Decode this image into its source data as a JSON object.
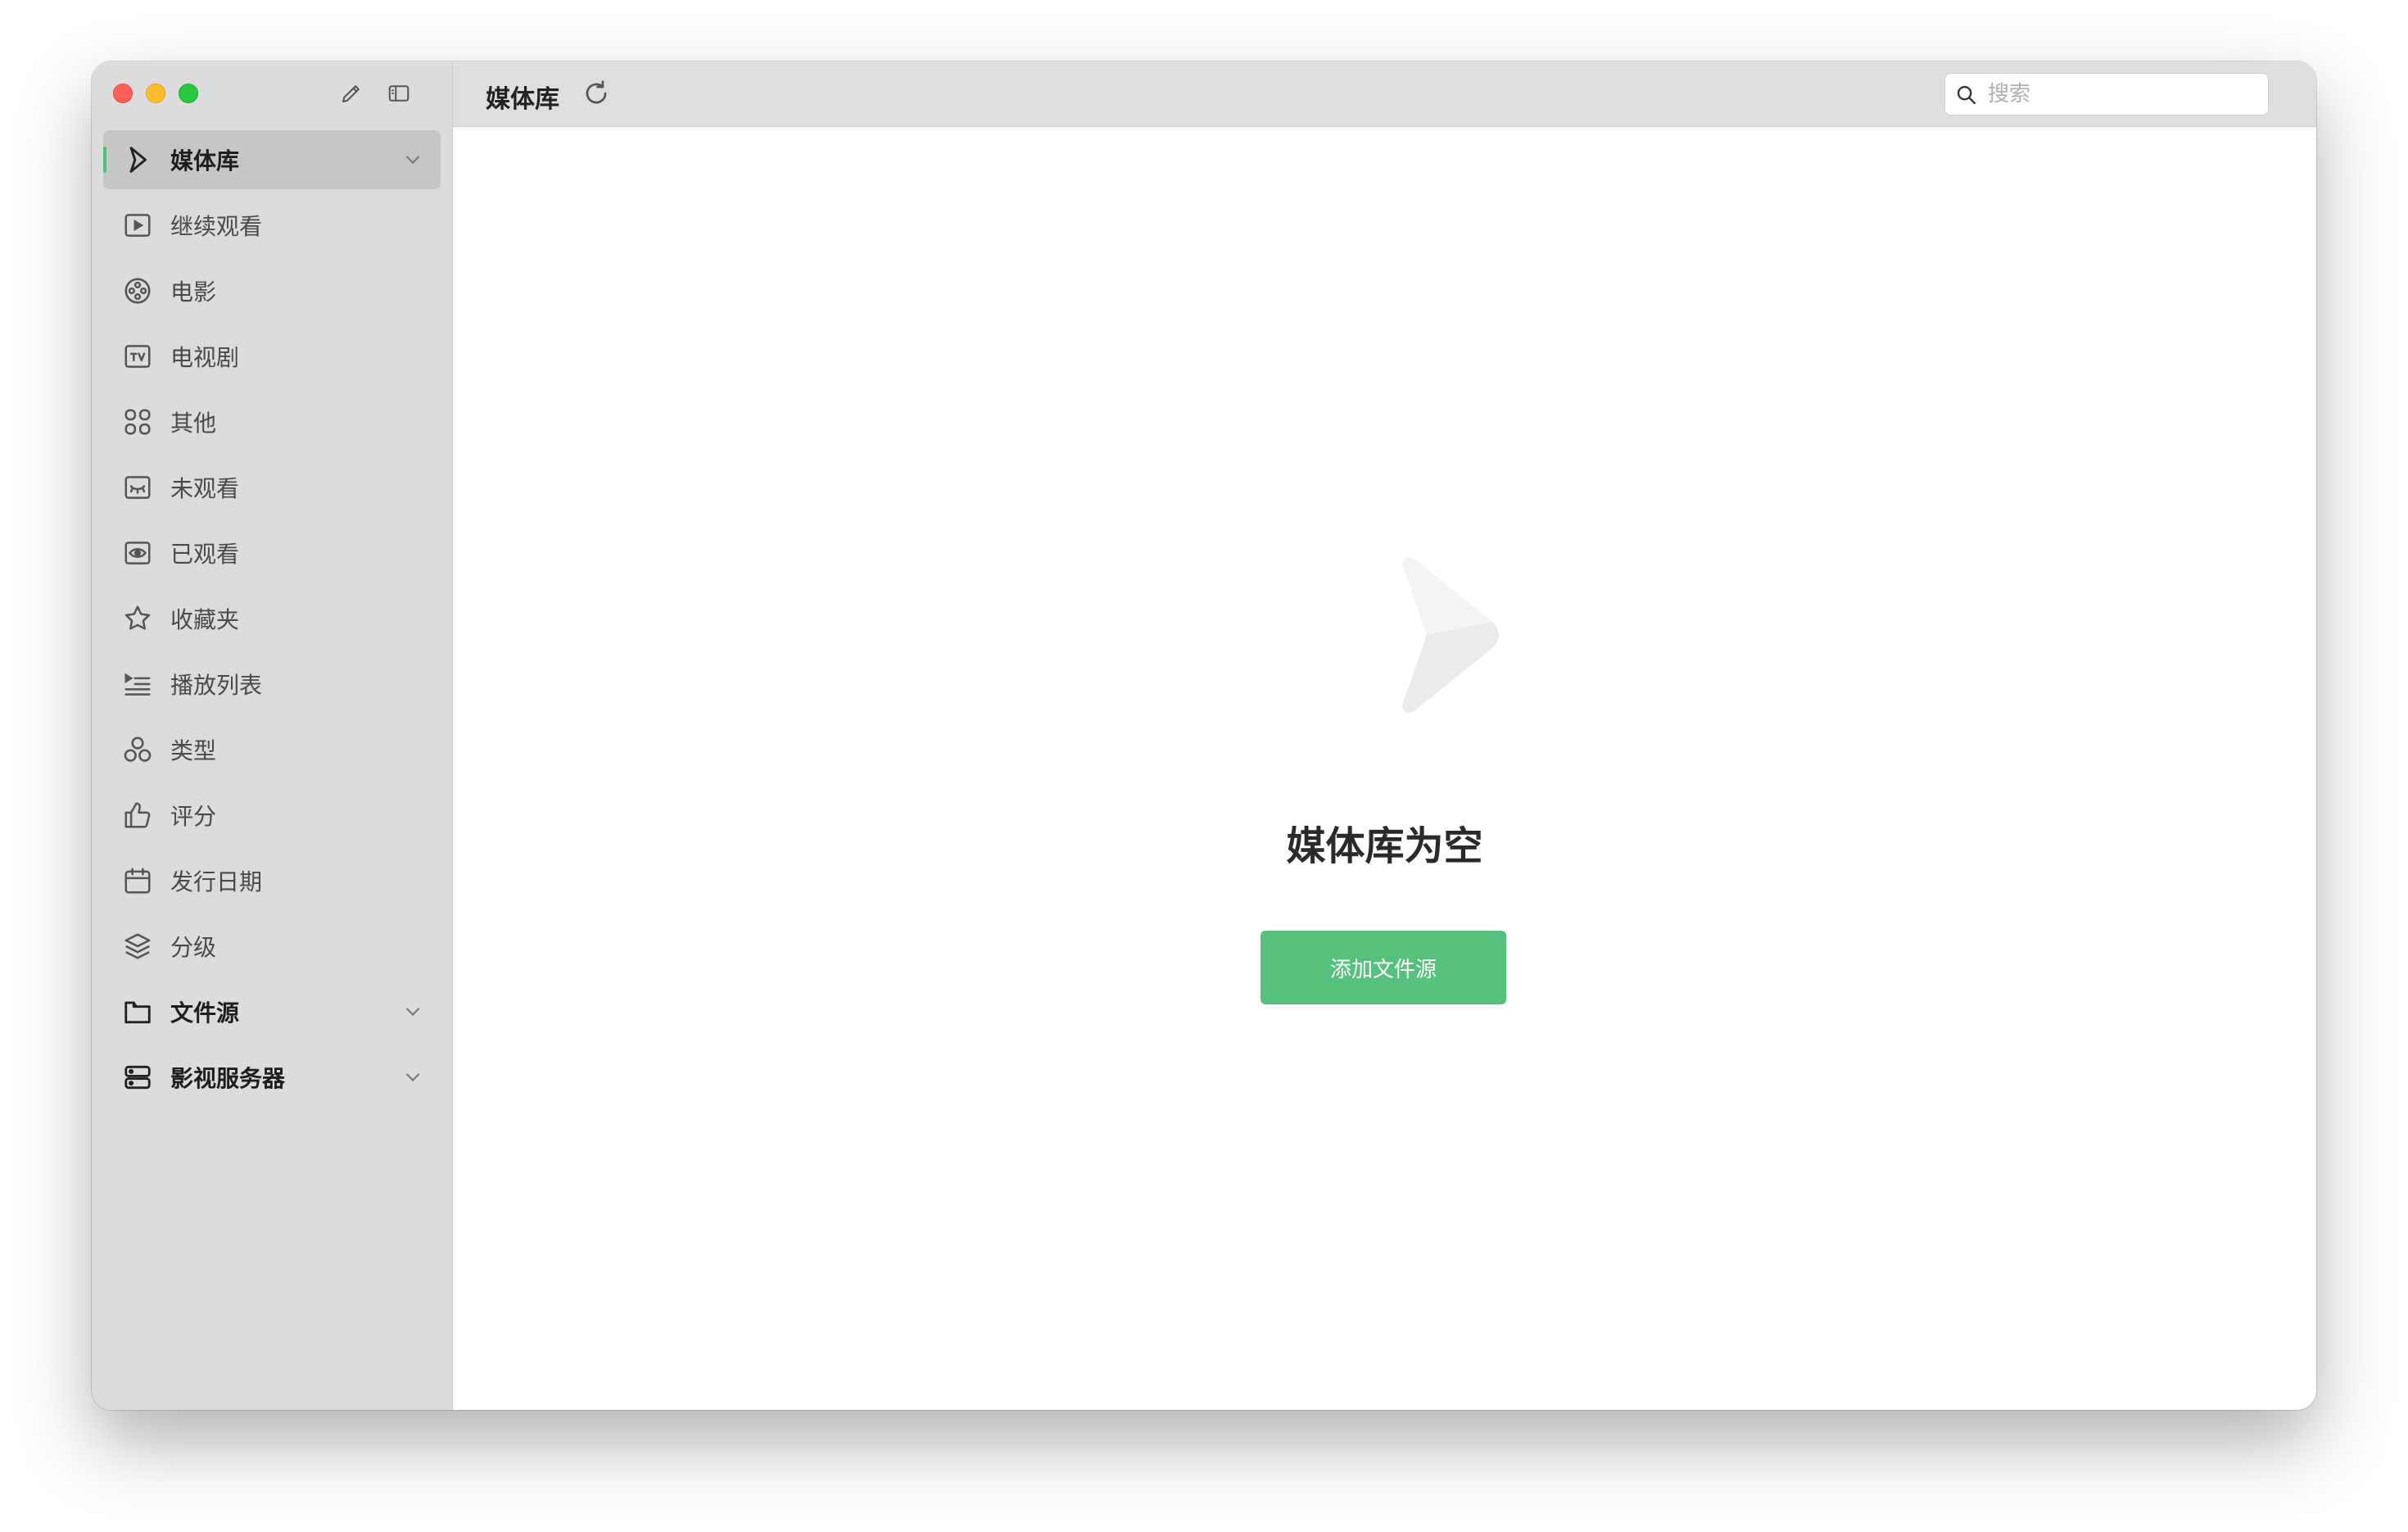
{
  "toolbar": {
    "title": "媒体库",
    "search_placeholder": "搜索"
  },
  "sidebar": {
    "items": [
      {
        "label": "媒体库",
        "icon": "media-library-icon"
      },
      {
        "label": "继续观看",
        "icon": "play-square-icon"
      },
      {
        "label": "电影",
        "icon": "film-reel-icon"
      },
      {
        "label": "电视剧",
        "icon": "tv-icon"
      },
      {
        "label": "其他",
        "icon": "grid-icon"
      },
      {
        "label": "未观看",
        "icon": "eye-closed-icon"
      },
      {
        "label": "已观看",
        "icon": "eye-icon"
      },
      {
        "label": "收藏夹",
        "icon": "star-icon"
      },
      {
        "label": "播放列表",
        "icon": "playlist-icon"
      },
      {
        "label": "类型",
        "icon": "genre-icon"
      },
      {
        "label": "评分",
        "icon": "thumbs-up-icon"
      },
      {
        "label": "发行日期",
        "icon": "calendar-icon"
      },
      {
        "label": "分级",
        "icon": "layers-icon"
      },
      {
        "label": "文件源",
        "icon": "folder-icon"
      },
      {
        "label": "影视服务器",
        "icon": "server-icon"
      }
    ]
  },
  "main": {
    "empty_title": "媒体库为空",
    "add_button": "添加文件源"
  },
  "colors": {
    "accent": "#56c17c",
    "sidebar_bg": "#dcdcdc",
    "active_item_bg": "#c6c6c6"
  }
}
